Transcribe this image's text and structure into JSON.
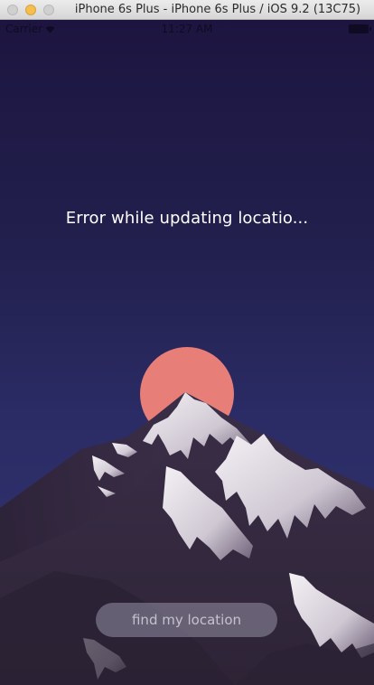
{
  "window": {
    "title": "iPhone 6s Plus - iPhone 6s Plus / iOS 9.2 (13C75)"
  },
  "status_bar": {
    "carrier": "Carrier",
    "time": "11:27 AM",
    "icons": [
      "wifi-icon",
      "battery-icon"
    ]
  },
  "main": {
    "message": "Error while updating locatio...",
    "button_label": "find my location"
  },
  "colors": {
    "sky_top": "#1d1540",
    "sky_bottom": "#2e2f6a",
    "sun": "#e87e78",
    "mountain": "#3a2e4a",
    "snow": "#e8e4ea"
  }
}
